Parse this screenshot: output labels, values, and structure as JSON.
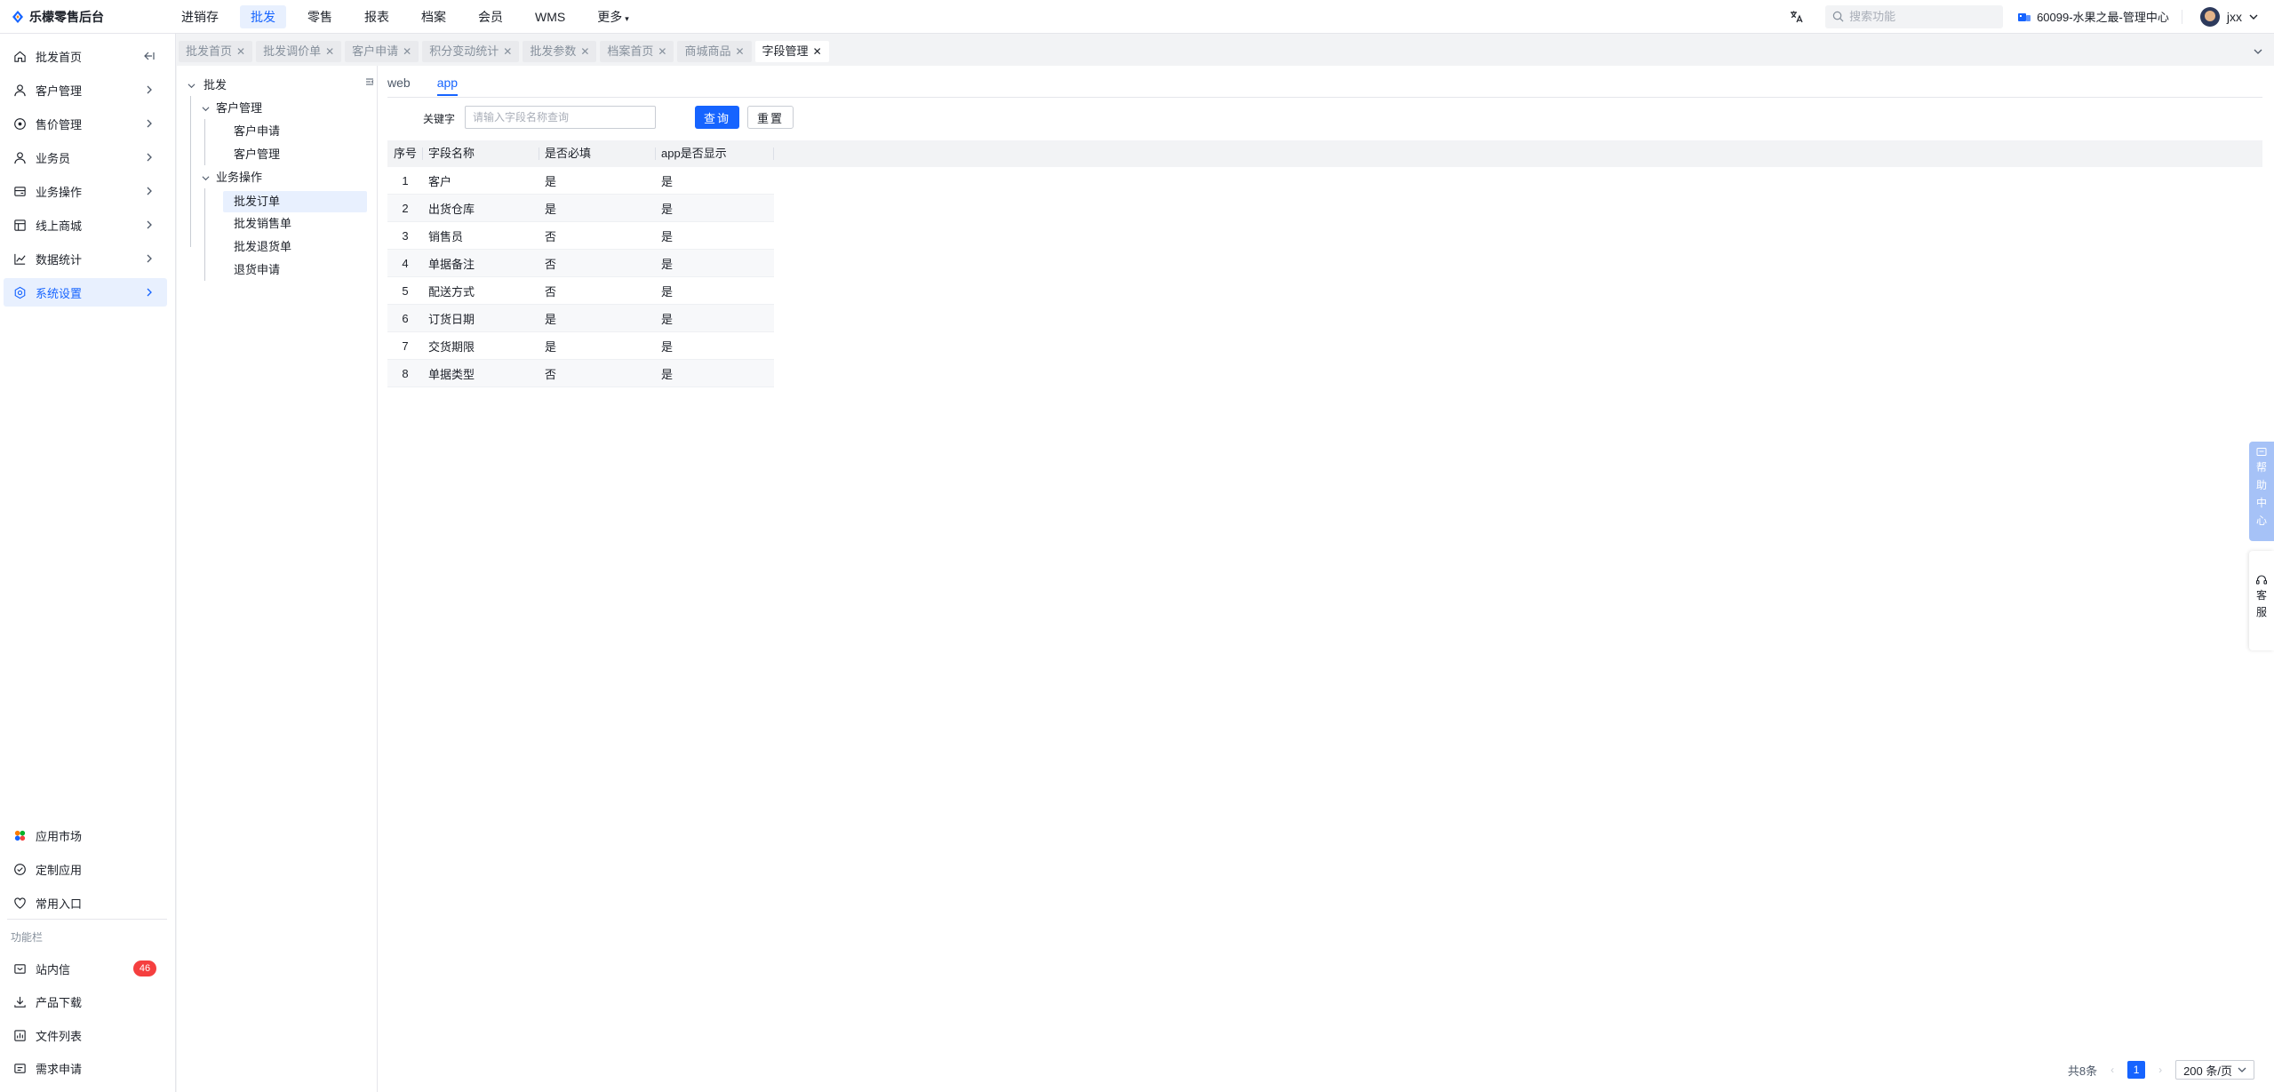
{
  "app": {
    "title": "乐檬零售后台"
  },
  "topnav": {
    "items": [
      {
        "label": "进销存",
        "active": false
      },
      {
        "label": "批发",
        "active": true
      },
      {
        "label": "零售",
        "active": false
      },
      {
        "label": "报表",
        "active": false
      },
      {
        "label": "档案",
        "active": false
      },
      {
        "label": "会员",
        "active": false
      },
      {
        "label": "WMS",
        "active": false
      },
      {
        "label": "更多",
        "active": false
      }
    ],
    "search_placeholder": "搜索功能",
    "store": "60099-水果之最-管理中心",
    "user": "jxx"
  },
  "sidebar": {
    "items": [
      {
        "label": "批发首页",
        "icon": "home-icon"
      },
      {
        "label": "客户管理",
        "icon": "user-icon"
      },
      {
        "label": "售价管理",
        "icon": "price-icon"
      },
      {
        "label": "业务员",
        "icon": "person-icon"
      },
      {
        "label": "业务操作",
        "icon": "operation-icon"
      },
      {
        "label": "线上商城",
        "icon": "shop-icon"
      },
      {
        "label": "数据统计",
        "icon": "chart-icon"
      },
      {
        "label": "系统设置",
        "icon": "settings-icon",
        "active": true
      }
    ],
    "bottom_items": [
      {
        "label": "应用市场",
        "icon": "app-market-icon"
      },
      {
        "label": "定制应用",
        "icon": "custom-app-icon"
      },
      {
        "label": "常用入口",
        "icon": "heart-icon"
      }
    ],
    "function_group_title": "功能栏",
    "function_items": [
      {
        "label": "站内信",
        "icon": "message-icon",
        "badge": "46"
      },
      {
        "label": "产品下载",
        "icon": "download-icon"
      },
      {
        "label": "文件列表",
        "icon": "file-list-icon"
      },
      {
        "label": "需求申请",
        "icon": "request-icon"
      }
    ]
  },
  "tabs": [
    {
      "label": "批发首页",
      "active": false
    },
    {
      "label": "批发调价单",
      "active": false
    },
    {
      "label": "客户申请",
      "active": false
    },
    {
      "label": "积分变动统计",
      "active": false
    },
    {
      "label": "批发参数",
      "active": false
    },
    {
      "label": "档案首页",
      "active": false
    },
    {
      "label": "商城商品",
      "active": false
    },
    {
      "label": "字段管理",
      "active": true
    }
  ],
  "tree": {
    "root": "批发",
    "groups": [
      {
        "label": "客户管理",
        "children": [
          "客户申请",
          "客户管理"
        ]
      },
      {
        "label": "业务操作",
        "children": [
          "批发订单",
          "批发销售单",
          "批发退货单",
          "退货申请"
        ]
      }
    ],
    "selected": "批发订单"
  },
  "subtabs": [
    {
      "label": "web",
      "active": false
    },
    {
      "label": "app",
      "active": true
    }
  ],
  "filter": {
    "label": "关键字",
    "placeholder": "请输入字段名称查询",
    "query_label": "查询",
    "reset_label": "重置"
  },
  "table": {
    "columns": [
      "序号",
      "字段名称",
      "是否必填",
      "app是否显示"
    ],
    "rows": [
      [
        "1",
        "客户",
        "是",
        "是"
      ],
      [
        "2",
        "出货仓库",
        "是",
        "是"
      ],
      [
        "3",
        "销售员",
        "否",
        "是"
      ],
      [
        "4",
        "单据备注",
        "否",
        "是"
      ],
      [
        "5",
        "配送方式",
        "否",
        "是"
      ],
      [
        "6",
        "订货日期",
        "是",
        "是"
      ],
      [
        "7",
        "交货期限",
        "是",
        "是"
      ],
      [
        "8",
        "单据类型",
        "否",
        "是"
      ]
    ]
  },
  "pager": {
    "total": "共8条",
    "current_page": "1",
    "page_size": "200 条/页"
  },
  "float": {
    "help_chars": [
      "帮",
      "助",
      "中",
      "心"
    ],
    "service_chars": [
      "客",
      "服"
    ]
  },
  "colors": {
    "accent": "#1664ff",
    "badge": "#f53f3f",
    "help_float": "#a6c2f7"
  }
}
